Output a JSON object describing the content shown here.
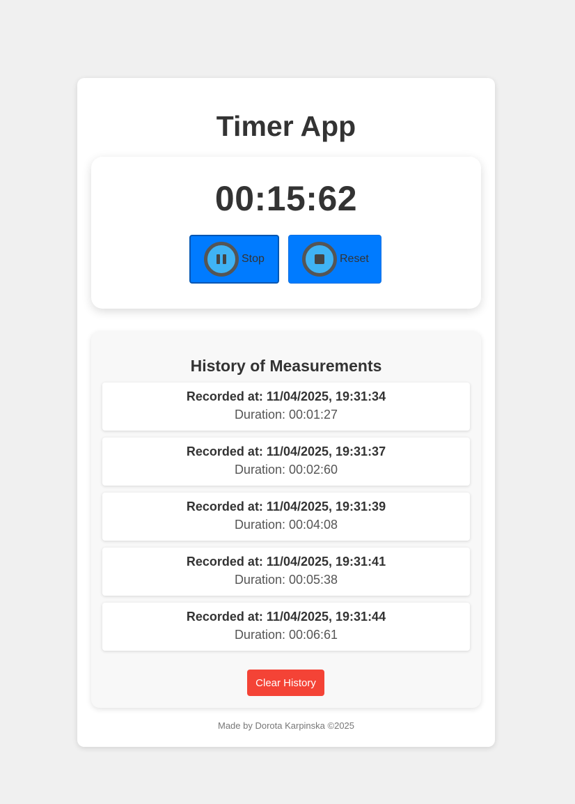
{
  "app": {
    "title": "Timer App"
  },
  "timer": {
    "display": "00:15:62",
    "stop_label": "Stop",
    "reset_label": "Reset",
    "stop_icon": "pause-icon",
    "reset_icon": "stop-icon"
  },
  "history": {
    "title": "History of Measurements",
    "items": [
      {
        "recorded": "Recorded at: 11/04/2025, 19:31:34",
        "duration": "Duration: 00:01:27"
      },
      {
        "recorded": "Recorded at: 11/04/2025, 19:31:37",
        "duration": "Duration: 00:02:60"
      },
      {
        "recorded": "Recorded at: 11/04/2025, 19:31:39",
        "duration": "Duration: 00:04:08"
      },
      {
        "recorded": "Recorded at: 11/04/2025, 19:31:41",
        "duration": "Duration: 00:05:38"
      },
      {
        "recorded": "Recorded at: 11/04/2025, 19:31:44",
        "duration": "Duration: 00:06:61"
      }
    ],
    "clear_label": "Clear History"
  },
  "footer": {
    "text": "Made by Dorota Karpinska ©2025"
  },
  "colors": {
    "background": "#f0f0f0",
    "accent": "#007bff",
    "danger": "#f44336",
    "text": "#333333"
  }
}
